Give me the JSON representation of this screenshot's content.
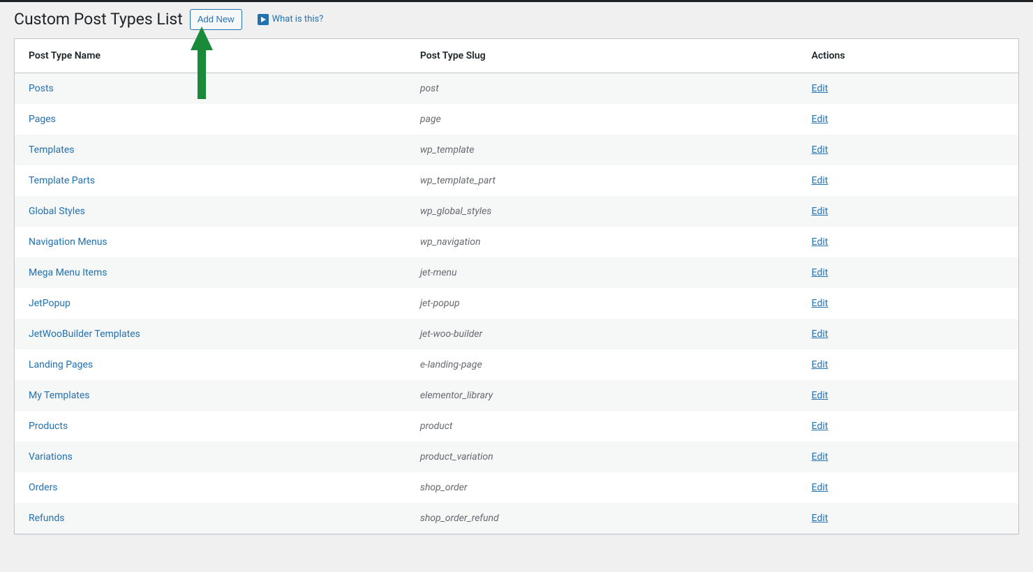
{
  "header": {
    "title": "Custom Post Types List",
    "add_new_label": "Add New",
    "what_is_this_label": "What is this?"
  },
  "table": {
    "columns": {
      "name": "Post Type Name",
      "slug": "Post Type Slug",
      "actions": "Actions"
    },
    "edit_label": "Edit",
    "rows": [
      {
        "name": "Posts",
        "slug": "post"
      },
      {
        "name": "Pages",
        "slug": "page"
      },
      {
        "name": "Templates",
        "slug": "wp_template"
      },
      {
        "name": "Template Parts",
        "slug": "wp_template_part"
      },
      {
        "name": "Global Styles",
        "slug": "wp_global_styles"
      },
      {
        "name": "Navigation Menus",
        "slug": "wp_navigation"
      },
      {
        "name": "Mega Menu Items",
        "slug": "jet-menu"
      },
      {
        "name": "JetPopup",
        "slug": "jet-popup"
      },
      {
        "name": "JetWooBuilder Templates",
        "slug": "jet-woo-builder"
      },
      {
        "name": "Landing Pages",
        "slug": "e-landing-page"
      },
      {
        "name": "My Templates",
        "slug": "elementor_library"
      },
      {
        "name": "Products",
        "slug": "product"
      },
      {
        "name": "Variations",
        "slug": "product_variation"
      },
      {
        "name": "Orders",
        "slug": "shop_order"
      },
      {
        "name": "Refunds",
        "slug": "shop_order_refund"
      }
    ]
  },
  "annotation": {
    "arrow_color": "#1a8a3a"
  }
}
